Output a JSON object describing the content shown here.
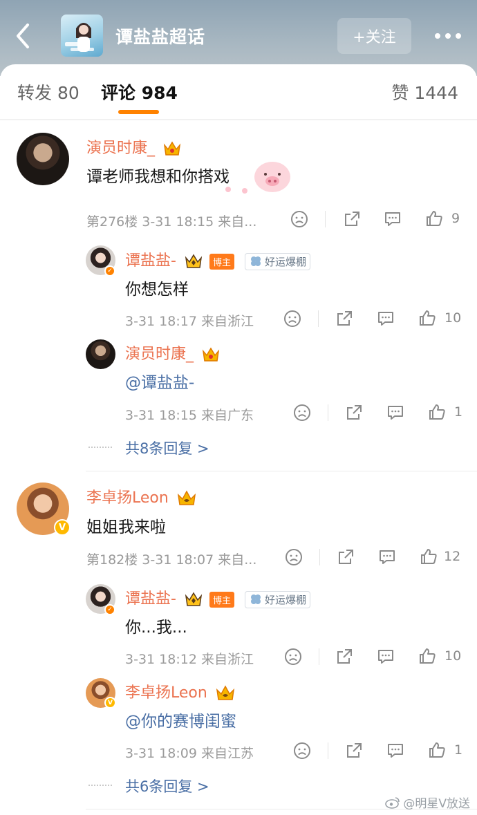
{
  "header": {
    "title": "谭盐盐超话",
    "follow_label": "+关注",
    "accent": "#ff8200"
  },
  "tabs": {
    "repost": "转发 80",
    "comment": "评论 984",
    "like": "赞 1444"
  },
  "comments": [
    {
      "user": "演员时康_",
      "text": "谭老师我想和你搭戏",
      "meta": "第276楼 3-31 18:15 来自...",
      "likes": "9",
      "replies": [
        {
          "user": "谭盐盐-",
          "tag": "博主",
          "badge": "好运爆棚",
          "text": "你想怎样",
          "meta": "3-31 18:17 来自浙江",
          "likes": "10"
        },
        {
          "user": "演员时康_",
          "text": "@谭盐盐-",
          "meta": "3-31 18:15 来自广东",
          "likes": "1"
        }
      ],
      "more_replies": "共8条回复 >"
    },
    {
      "user": "李卓扬Leon",
      "text": "姐姐我来啦",
      "meta": "第182楼 3-31 18:07 来自...",
      "likes": "12",
      "replies": [
        {
          "user": "谭盐盐-",
          "tag": "博主",
          "badge": "好运爆棚",
          "text": "你...我...",
          "meta": "3-31 18:12 来自浙江",
          "likes": "10"
        },
        {
          "user": "李卓扬Leon",
          "text": "@你的赛博闺蜜",
          "meta": "3-31 18:09 来自江苏",
          "likes": "1"
        }
      ],
      "more_replies": "共6条回复 >"
    }
  ],
  "icons": [
    "back-arrow-icon",
    "more-dots-icon",
    "crown-icon",
    "clover-icon",
    "dislike-icon",
    "share-icon",
    "comment-icon",
    "thumbs-up-icon",
    "verified-icon"
  ],
  "watermark": "@明星V放送"
}
